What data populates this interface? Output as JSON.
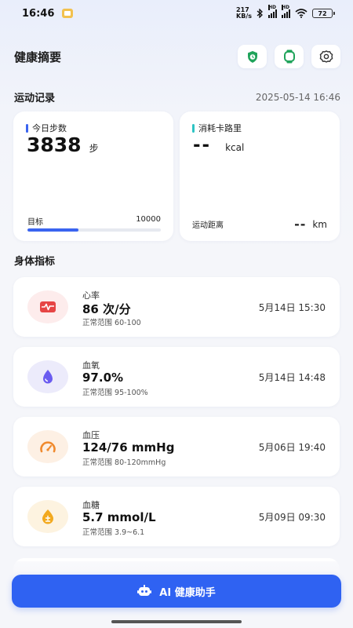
{
  "status_bar": {
    "time": "16:46",
    "net_speed_value": "217",
    "net_speed_unit": "KB/s",
    "signal_label_1": "HD",
    "signal_label_2": "HD",
    "battery": "72"
  },
  "header": {
    "title": "健康摘要",
    "icons": [
      "shield-clock-icon",
      "watch-icon",
      "gear-icon"
    ]
  },
  "activity": {
    "section_title": "运动记录",
    "timestamp": "2025-05-14 16:46",
    "steps": {
      "label": "今日步数",
      "value": "3838",
      "unit": "步",
      "goal_label": "目标",
      "goal_value": "10000",
      "progress_fraction": 0.3838
    },
    "calories": {
      "label": "消耗卡路里",
      "value": "--",
      "unit": "kcal",
      "distance_label": "运动距离",
      "distance_value": "--",
      "distance_unit": "km"
    }
  },
  "body_metrics": {
    "section_title": "身体指标",
    "items": [
      {
        "name": "心率",
        "value": "86 次/分",
        "range": "正常范围 60-100",
        "time": "5月14日 15:30",
        "icon": "heart-rate-icon"
      },
      {
        "name": "血氧",
        "value": "97.0%",
        "range": "正常范围 95-100%",
        "time": "5月14日 14:48",
        "icon": "drop-icon"
      },
      {
        "name": "血压",
        "value": "124/76 mmHg",
        "range": "正常范围 80-120mmHg",
        "time": "5月06日 19:40",
        "icon": "gauge-icon"
      },
      {
        "name": "血糖",
        "value": "5.7 mmol/L",
        "range": "正常范围 3.9~6.1",
        "time": "5月09日 09:30",
        "icon": "sugar-drop-icon"
      }
    ]
  },
  "ai_button": {
    "label": "AI 健康助手",
    "icon": "robot-icon"
  },
  "colors": {
    "accent": "#2f62f2",
    "steps_bar": "#3a64f0",
    "calories_bar": "#2ec4c4",
    "heart_bg": "#fdecec",
    "heart_fg": "#e64545",
    "oxygen_bg": "#ecebfb",
    "oxygen_fg": "#6a5cf0",
    "pressure_bg": "#fdf0e4",
    "pressure_fg": "#f08a2e",
    "sugar_bg": "#fdf3e0",
    "sugar_fg": "#f2a91e"
  }
}
